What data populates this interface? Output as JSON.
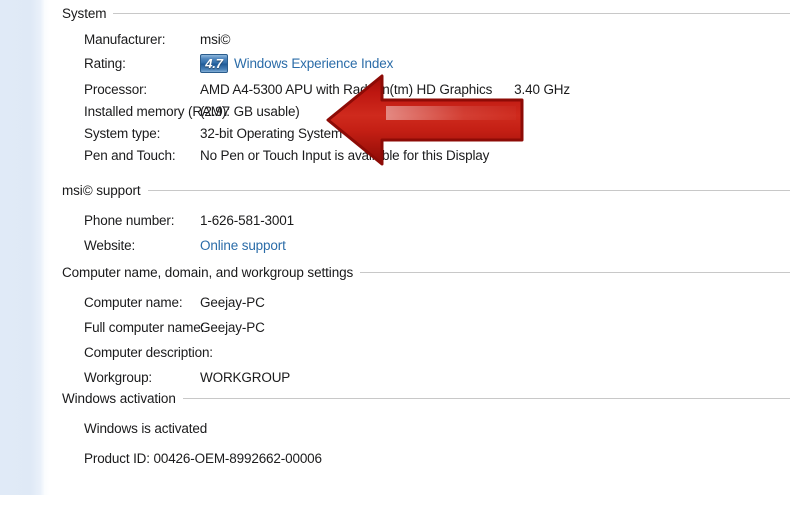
{
  "page": {
    "background_color": "#ffffff",
    "gutter_color": "#dfe9f6",
    "link_color": "#2b6ca8",
    "rule_color": "#c8c8c8",
    "text_color": "#1b1b1c"
  },
  "sections": {
    "system": {
      "title": "System",
      "rows": {
        "manufacturer": {
          "label": "Manufacturer:",
          "value": "msi©"
        },
        "rating": {
          "label": "Rating:",
          "score": "4.7",
          "link_text": "Windows Experience Index"
        },
        "processor": {
          "label": "Processor:",
          "value": "AMD A4-5300 APU with Radeon(tm) HD Graphics",
          "speed": "3.40 GHz"
        },
        "memory": {
          "label": "Installed memory (RAM):",
          "value": "(2.97 GB usable)"
        },
        "system_type": {
          "label": "System type:",
          "value": "32-bit Operating System"
        },
        "pen_and_touch": {
          "label": "Pen and Touch:",
          "value": "No Pen or Touch Input is available for this Display"
        }
      }
    },
    "support": {
      "title": "msi© support",
      "rows": {
        "phone": {
          "label": "Phone number:",
          "value": "1-626-581-3001"
        },
        "website": {
          "label": "Website:",
          "link_text": "Online support"
        }
      }
    },
    "computer_name": {
      "title": "Computer name, domain, and workgroup settings",
      "rows": {
        "computer_name": {
          "label": "Computer name:",
          "value": "Geejay-PC"
        },
        "full_computer_name": {
          "label": "Full computer name:",
          "value": "Geejay-PC"
        },
        "computer_description": {
          "label": "Computer description:",
          "value": ""
        },
        "workgroup": {
          "label": "Workgroup:",
          "value": "WORKGROUP"
        }
      }
    },
    "activation": {
      "title": "Windows activation",
      "status_text": "Windows is activated",
      "product_id_text": "Product ID: 00426-OEM-8992662-00006"
    }
  },
  "annotation": {
    "arrow": {
      "name": "red-left-arrow",
      "direction": "left",
      "fill_color": "#c0170f",
      "border_color": "#8d0b06",
      "target_label": "Installed memory (RAM)"
    }
  }
}
